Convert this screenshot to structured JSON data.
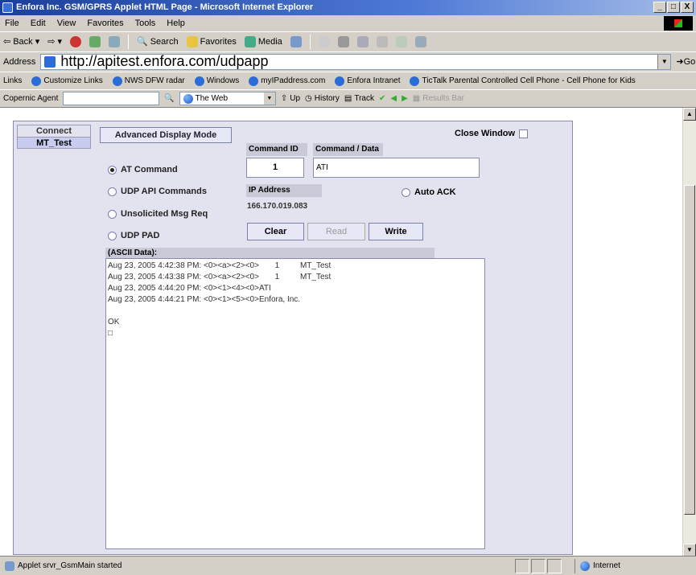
{
  "window": {
    "title": "Enfora Inc. GSM/GPRS Applet HTML Page - Microsoft Internet Explorer",
    "min": "_",
    "max": "□",
    "close": "X"
  },
  "menu": [
    "File",
    "Edit",
    "View",
    "Favorites",
    "Tools",
    "Help"
  ],
  "toolbar": {
    "back": "Back",
    "search": "Search",
    "favorites": "Favorites",
    "media": "Media"
  },
  "address": {
    "label": "Address",
    "url": "http://apitest.enfora.com/udpapp",
    "go": "Go"
  },
  "links": {
    "label": "Links",
    "items": [
      "Customize Links",
      "NWS DFW radar",
      "Windows",
      "myIPaddress.com",
      "Enfora Intranet",
      "TicTalk Parental Controlled Cell Phone - Cell Phone for Kids"
    ]
  },
  "copernic": {
    "label": "Copernic Agent",
    "search_scope": "The Web",
    "up": "Up",
    "history": "History",
    "track": "Track",
    "results_bar": "Results Bar"
  },
  "applet": {
    "tabs": [
      {
        "label": "Connect",
        "active": false
      },
      {
        "label": "MT_Test",
        "active": true
      }
    ],
    "advanced_button": "Advanced Display Mode",
    "close_window": "Close Window",
    "command_id_header": "Command ID",
    "command_data_header": "Command / Data",
    "command_id_value": "1",
    "command_data_value": "ATI",
    "radios": [
      {
        "label": "AT Command",
        "checked": true
      },
      {
        "label": "UDP API Commands",
        "checked": false
      },
      {
        "label": "Unsolicited Msg Req",
        "checked": false
      },
      {
        "label": "UDP PAD",
        "checked": false
      }
    ],
    "ip_header": "IP Address",
    "ip_value": "166.170.019.083",
    "auto_ack": "Auto ACK",
    "buttons": {
      "clear": "Clear",
      "read": "Read",
      "write": "Write"
    },
    "ascii_header": "(ASCII Data):",
    "log": [
      {
        "text": "Aug 23, 2005 4:42:38 PM: <0><a><2><0>",
        "id": "1",
        "tab": "MT_Test"
      },
      {
        "text": "Aug 23, 2005 4:43:38 PM: <0><a><2><0>",
        "id": "1",
        "tab": "MT_Test"
      },
      {
        "text": "Aug 23, 2005 4:44:20 PM: <0><1><4><0>ATI",
        "id": "",
        "tab": ""
      },
      {
        "text": "Aug 23, 2005 4:44:21 PM: <0><1><5><0>Enfora, Inc.",
        "id": "",
        "tab": ""
      },
      {
        "text": "",
        "id": "",
        "tab": ""
      },
      {
        "text": "OK",
        "id": "",
        "tab": ""
      },
      {
        "text": "□",
        "id": "",
        "tab": ""
      }
    ]
  },
  "status": {
    "text": "Applet srvr_GsmMain started",
    "zone": "Internet"
  }
}
